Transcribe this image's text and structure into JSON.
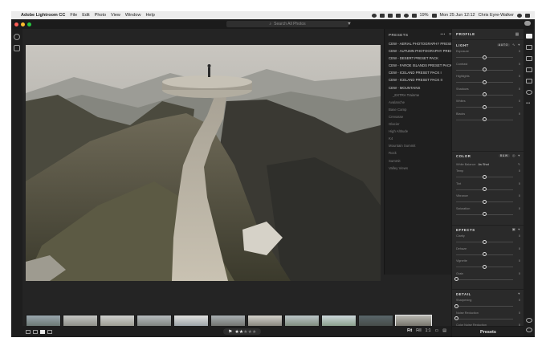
{
  "menubar": {
    "app_name": "Adobe Lightroom CC",
    "items": [
      "File",
      "Edit",
      "Photo",
      "View",
      "Window",
      "Help"
    ],
    "battery": "19%",
    "datetime": "Mon 25 Jun 12:12",
    "user": "Chris Eyre-Walker"
  },
  "toolbar": {
    "search_placeholder": "Search All Photos"
  },
  "presets": {
    "title": "PRESETS",
    "items": [
      "CEW - AERIAL PHOTOGRAPHY PRESET PACK",
      "CEW - AUTUMN PHOTOGRAPHY PRESET",
      "CEW - DESERT PRESET PACK",
      "CEW - FAROE ISLANDS PRESET PACK",
      "CEW - ICELAND PRESET PACK I",
      "CEW - ICELAND PRESET PACK II",
      "CEW - MOUNTAINS"
    ],
    "sub_items": [
      "_EXTRA Trainme",
      "Avalanche",
      "Base Camp",
      "Crevasse",
      "Glacier",
      "High Altitude",
      "K4",
      "Mountain Summit",
      "Rock",
      "Summit",
      "Valley Views"
    ]
  },
  "edit": {
    "profile_label": "PROFILE",
    "light": {
      "title": "LIGHT",
      "auto_label": "AUTO",
      "sliders": [
        {
          "label": "Exposure",
          "value": "0",
          "pos": 0.5
        },
        {
          "label": "Contrast",
          "value": "0",
          "pos": 0.5
        },
        {
          "label": "Highlights",
          "value": "0",
          "pos": 0.5
        },
        {
          "label": "Shadows",
          "value": "0",
          "pos": 0.5
        },
        {
          "label": "Whites",
          "value": "0",
          "pos": 0.5
        },
        {
          "label": "Blacks",
          "value": "0",
          "pos": 0.5
        }
      ]
    },
    "color": {
      "title": "COLOR",
      "bw_label": "B&W",
      "white_balance_label": "White Balance",
      "white_balance_value": "As Shot",
      "sliders": [
        {
          "label": "Temp",
          "value": "0",
          "pos": 0.5
        },
        {
          "label": "Tint",
          "value": "0",
          "pos": 0.5
        },
        {
          "label": "Vibrance",
          "value": "0",
          "pos": 0.5
        },
        {
          "label": "Saturation",
          "value": "0",
          "pos": 0.5
        }
      ]
    },
    "effects": {
      "title": "EFFECTS",
      "sliders": [
        {
          "label": "Clarity",
          "value": "0",
          "pos": 0.5
        },
        {
          "label": "Dehaze",
          "value": "0",
          "pos": 0.5
        },
        {
          "label": "Vignette",
          "value": "0",
          "pos": 0.5
        },
        {
          "label": "Grain",
          "value": "0",
          "pos": 0.0
        }
      ]
    },
    "detail": {
      "title": "DETAIL",
      "sliders": [
        {
          "label": "Sharpening",
          "value": "0",
          "pos": 0.0
        },
        {
          "label": "Noise Reduction",
          "value": "0",
          "pos": 0.0
        },
        {
          "label": "Color Noise Reduction",
          "value": "0",
          "pos": 0.0
        }
      ]
    },
    "footer_label": "Presets"
  },
  "bottombar": {
    "rating_stars": "★★★★★",
    "rating_value": 2,
    "zoom_fit": "Fit",
    "zoom_fill": "Fill",
    "zoom_1to1": "1:1"
  },
  "colors": {
    "accent": "#e8e8e8",
    "panel": "#2a2a2a",
    "background": "#242424"
  }
}
